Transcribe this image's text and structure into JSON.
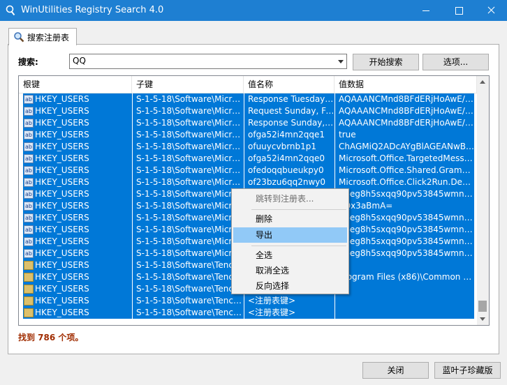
{
  "window": {
    "title": "WinUtilities Registry Search 4.0"
  },
  "tab": {
    "label": "搜索注册表"
  },
  "search": {
    "label": "搜索:",
    "value": "QQ",
    "start_button": "开始搜索",
    "options_button": "选项..."
  },
  "table": {
    "columns": [
      "根键",
      "子键",
      "值名称",
      "值数据"
    ],
    "rows": [
      {
        "icon": "string-value-icon",
        "root": "HKEY_USERS",
        "subkey": "S-1-5-18\\Software\\Microsof...",
        "name": "Response Tuesday, F...",
        "data": "AQAAANCMnd8BFdERjHoAwE/Cl+sB..."
      },
      {
        "icon": "string-value-icon",
        "root": "HKEY_USERS",
        "subkey": "S-1-5-18\\Software\\Microsof...",
        "name": "Request Sunday, Feb...",
        "data": "AQAAANCMnd8BFdERjHoAwE/Cl+sB..."
      },
      {
        "icon": "string-value-icon",
        "root": "HKEY_USERS",
        "subkey": "S-1-5-18\\Software\\Microsof...",
        "name": "Response Sunday, Fe...",
        "data": "AQAAANCMnd8BFdERjHoAwE/Cl+sB..."
      },
      {
        "icon": "string-value-icon",
        "root": "HKEY_USERS",
        "subkey": "S-1-5-18\\Software\\Microsof...",
        "name": "ofga52i4mn2qqe1",
        "data": "true"
      },
      {
        "icon": "string-value-icon",
        "root": "HKEY_USERS",
        "subkey": "S-1-5-18\\Software\\Microsof...",
        "name": "ofuuycvbrnb1p1",
        "data": "ChAGMiQ2ADcAYgBlAGEANwBkADIA..."
      },
      {
        "icon": "string-value-icon",
        "root": "HKEY_USERS",
        "subkey": "S-1-5-18\\Software\\Microsof...",
        "name": "ofga52i4mn2qqe0",
        "data": "Microsoft.Office.TargetedMessaging..."
      },
      {
        "icon": "string-value-icon",
        "root": "HKEY_USERS",
        "subkey": "S-1-5-18\\Software\\Microsof...",
        "name": "ofedoqqbueukpy0",
        "data": "Microsoft.Office.Shared.GrammarCh..."
      },
      {
        "icon": "string-value-icon",
        "root": "HKEY_USERS",
        "subkey": "S-1-5-18\\Software\\Microsof...",
        "name": "of23bzu6qq2nwy0",
        "data": "Microsoft.Office.Click2Run.Deprecat..."
      },
      {
        "icon": "string-value-icon",
        "root": "HKEY_USERS",
        "subkey": "S-1-5-18\\Software\\Microsof...",
        "name": "",
        "data": "X6eg8h5sxqq90pv53845wmnbe..."
      },
      {
        "icon": "string-value-icon",
        "root": "HKEY_USERS",
        "subkey": "S-1-5-18\\Software\\Microsof...",
        "name": "",
        "data": "7Qx3aBmA="
      },
      {
        "icon": "string-value-icon",
        "root": "HKEY_USERS",
        "subkey": "S-1-5-18\\Software\\Microsof...",
        "name": "",
        "data": "X6eg8h5sxqq90pv53845wmnbe..."
      },
      {
        "icon": "string-value-icon",
        "root": "HKEY_USERS",
        "subkey": "S-1-5-18\\Software\\Microsof...",
        "name": "",
        "data": "X6eg8h5sxqq90pv53845wmnbe..."
      },
      {
        "icon": "string-value-icon",
        "root": "HKEY_USERS",
        "subkey": "S-1-5-18\\Software\\Microsof...",
        "name": "",
        "data": "X6eg8h5sxqq90pv53845wmnbe..."
      },
      {
        "icon": "string-value-icon",
        "root": "HKEY_USERS",
        "subkey": "S-1-5-18\\Software\\Microsof...",
        "name": "",
        "data": "X6eg8h5sxqq90pv53845wmnbe..."
      },
      {
        "icon": "folder-icon",
        "root": "HKEY_USERS",
        "subkey": "S-1-5-18\\Software\\Tencent...",
        "name": "",
        "data": ""
      },
      {
        "icon": "folder-icon",
        "root": "HKEY_USERS",
        "subkey": "S-1-5-18\\Software\\Tencent...",
        "name": "",
        "data": "Program Files (x86)\\Common File..."
      },
      {
        "icon": "folder-icon",
        "root": "HKEY_USERS",
        "subkey": "S-1-5-18\\Software\\Tencent...",
        "name": "",
        "data": ""
      },
      {
        "icon": "folder-icon",
        "root": "HKEY_USERS",
        "subkey": "S-1-5-18\\Software\\Tencent...",
        "name": "<注册表键>",
        "data": ""
      },
      {
        "icon": "folder-icon",
        "root": "HKEY_USERS",
        "subkey": "S-1-5-18\\Software\\Tencent...",
        "name": "<注册表键>",
        "data": ""
      }
    ]
  },
  "context_menu": {
    "items": [
      "跳转到注册表...",
      "删除",
      "导出",
      "全选",
      "取消全选",
      "反向选择"
    ],
    "disabled_item": "跳转到注册表...",
    "highlighted_item": "导出"
  },
  "status": {
    "found_text": "找到 786 个项。"
  },
  "buttons": {
    "close": "关闭",
    "brand": "蓝叶子珍藏版"
  },
  "colors": {
    "titlebar": "#1e7fd2",
    "selection": "#0078d7",
    "menu_highlight": "#91c9f7",
    "status_text": "#a02c00"
  }
}
